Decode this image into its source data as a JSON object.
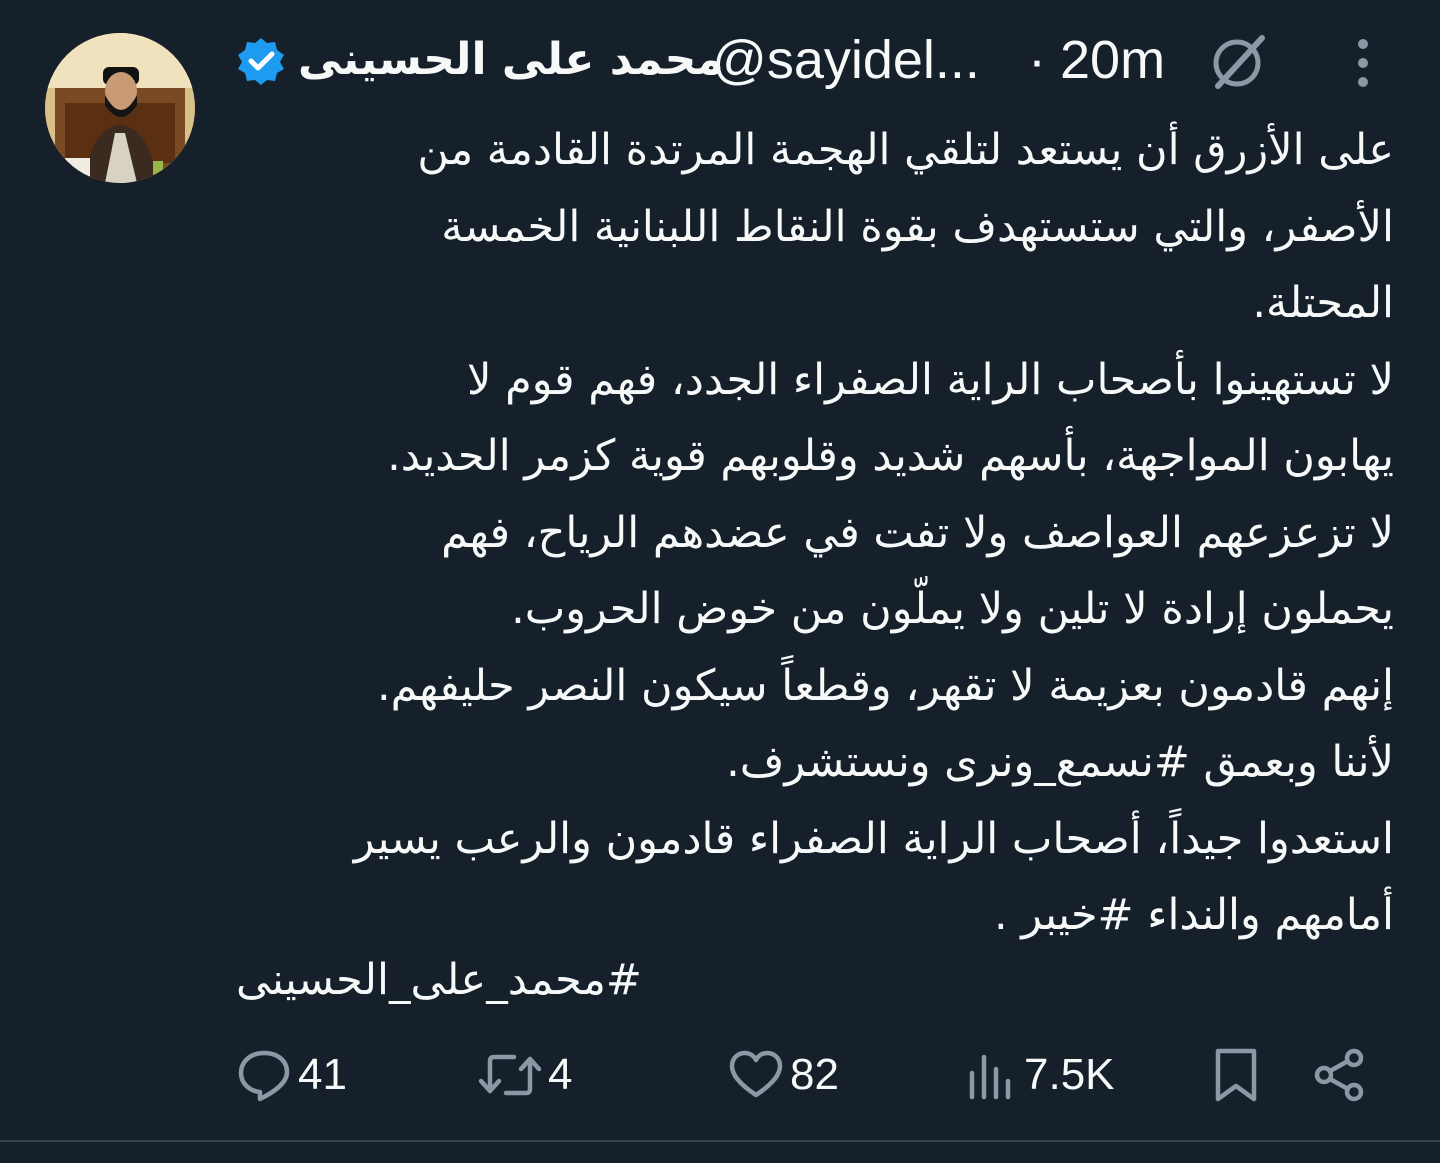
{
  "author": {
    "display_name": "محمد على الحسينى",
    "handle": "@sayidel...",
    "verified": true,
    "avatar": "profile-photo"
  },
  "meta": {
    "separator": "·",
    "time": "20m",
    "grok_icon": "grok-icon",
    "more_icon": "more-vertical-icon"
  },
  "tweet": {
    "lines": [
      "على الأزرق أن يستعد لتلقي الهجمة المرتدة القادمة من",
      "الأصفر، والتي ستستهدف بقوة النقاط اللبنانية الخمسة",
      "المحتلة.",
      "لا تستهينوا بأصحاب الراية الصفراء الجدد، فهم قوم لا",
      "يهابون المواجهة، بأسهم شديد وقلوبهم قوية كزمر الحديد.",
      "لا تزعزعهم العواصف ولا تفت في عضدهم الرياح، فهم",
      "يحملون إرادة لا تلين ولا يملّون من خوض الحروب.",
      "إنهم قادمون بعزيمة لا تقهر، وقطعاً سيكون النصر حليفهم.",
      "لأننا وبعمق #نسمع_ونرى ونستشرف.",
      "استعدوا جيداً، أصحاب الراية الصفراء قادمون والرعب يسير",
      "أمامهم والنداء #خيبر ."
    ],
    "signature": "#محمد_على_الحسينى"
  },
  "actions": {
    "replies": {
      "icon": "reply-icon",
      "count": "41"
    },
    "retweets": {
      "icon": "retweet-icon",
      "count": "4"
    },
    "likes": {
      "icon": "heart-icon",
      "count": "82"
    },
    "views": {
      "icon": "views-icon",
      "count": "7.5K"
    },
    "bookmark": {
      "icon": "bookmark-icon"
    },
    "share": {
      "icon": "share-icon"
    }
  },
  "colors": {
    "background": "#15202b",
    "text": "#f7f9f9",
    "secondary": "#8b98a5",
    "verified": "#1d9bf0",
    "divider": "#38444d"
  }
}
